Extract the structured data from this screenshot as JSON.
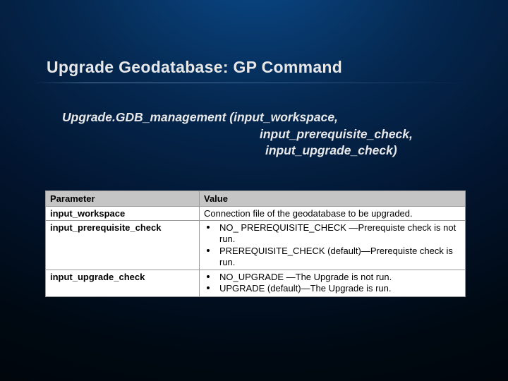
{
  "slide": {
    "title": "Upgrade Geodatabase: GP Command",
    "signature": {
      "line1": "Upgrade.GDB_management (input_workspace,",
      "line2": "input_prerequisite_check,",
      "line3": "input_upgrade_check)"
    }
  },
  "table": {
    "headers": {
      "col1": "Parameter",
      "col2": "Value"
    },
    "rows": [
      {
        "param": "input_workspace",
        "value_text": "Connection file of the geodatabase to be upgraded."
      },
      {
        "param": "input_prerequisite_check",
        "bullets": [
          "NO_ PREREQUISITE_CHECK —Prerequiste check is not run.",
          "PREREQUISITE_CHECK (default)—Prerequiste check is run."
        ]
      },
      {
        "param": "input_upgrade_check",
        "bullets": [
          "NO_UPGRADE —The Upgrade is not run.",
          "UPGRADE (default)—The Upgrade is run."
        ]
      }
    ]
  }
}
